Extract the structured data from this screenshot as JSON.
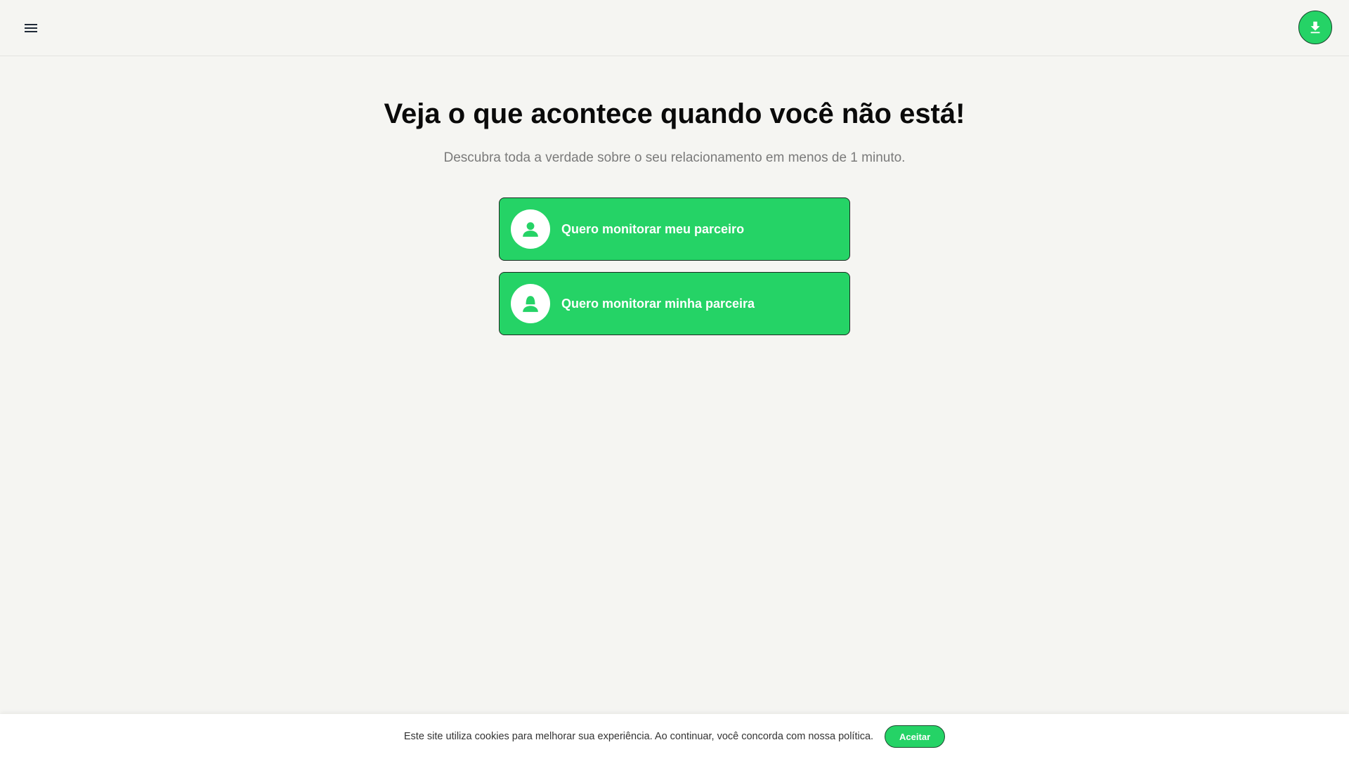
{
  "header": {
    "menu_icon": "menu-icon",
    "download_icon": "download-icon"
  },
  "hero": {
    "title": "Veja o que acontece quando você não está!",
    "subtitle": "Descubra toda a verdade sobre o seu relacionamento em menos de 1 minuto."
  },
  "options": [
    {
      "label": "Quero monitorar meu parceiro",
      "icon": "male-user-icon"
    },
    {
      "label": "Quero monitorar minha parceira",
      "icon": "female-user-icon"
    }
  ],
  "cookie_banner": {
    "text": "Este site utiliza cookies para melhorar sua experiência. Ao continuar, você concorda com nossa política.",
    "accept_label": "Aceitar"
  },
  "colors": {
    "accent": "#25d366",
    "background": "#f5f5f2",
    "title": "#0a0a0a",
    "subtitle": "#7a7a7a"
  }
}
